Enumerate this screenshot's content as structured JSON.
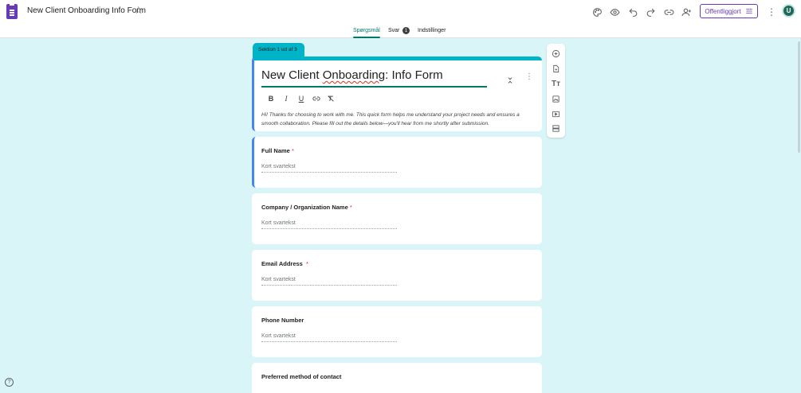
{
  "header": {
    "title": "New Client Onboarding Info Form",
    "publish_label": "Offentliggjort",
    "avatar_letter": "U",
    "icons": [
      "palette-icon",
      "eye-icon",
      "undo-icon",
      "redo-icon",
      "link-icon",
      "add-person-icon",
      "tune-icon",
      "more-vert-icon"
    ]
  },
  "tabs": [
    {
      "label": "Spørgsmål",
      "active": true
    },
    {
      "label": "Svar",
      "badge": "1"
    },
    {
      "label": "Indstillinger"
    }
  ],
  "section": {
    "label": "Sektion 1 ud af 3"
  },
  "form": {
    "title_pre": "New Client ",
    "title_misspelled": "Onboarding",
    "title_post": ": Info Form",
    "description": "Hi! Thanks for choosing to work with me. This quick form helps me understand your project needs and ensures a smooth collaboration. Please fill out the details below—you'll hear from me shortly after submission.",
    "format_tools": [
      "B",
      "I",
      "U"
    ]
  },
  "questions": [
    {
      "label": "Full Name",
      "required": "*",
      "placeholder": "Kort svartekst"
    },
    {
      "label": "Company / Organization Name",
      "required": "*",
      "placeholder": "Kort svartekst"
    },
    {
      "label": "Email Address ",
      "required": "*",
      "placeholder": "Kort svartekst"
    },
    {
      "label": "Phone Number",
      "required": "",
      "placeholder": "Kort svartekst"
    },
    {
      "label": "Preferred method of contact",
      "required": "",
      "placeholder": ""
    }
  ],
  "floating_toolbar": [
    "add-question-icon",
    "import-questions-icon",
    "add-title-icon",
    "add-image-icon",
    "add-video-icon",
    "add-section-icon"
  ],
  "help": "?"
}
